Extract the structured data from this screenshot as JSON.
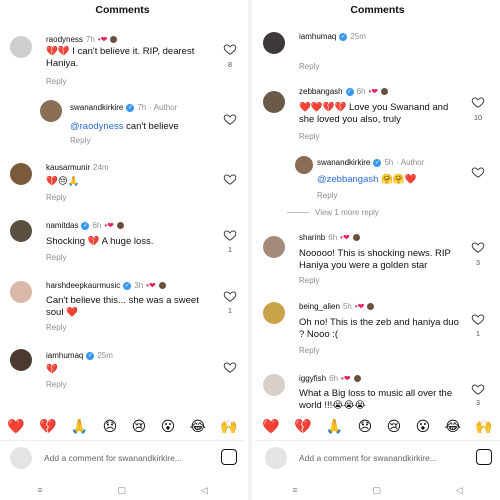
{
  "left": {
    "title": "Comments",
    "comments": [
      {
        "user": "raodyness",
        "time": "7h",
        "text": "💔💔 I can't believe it. RIP, dearest Haniya.",
        "reply": "Reply",
        "likes": "8"
      },
      {
        "user": "swanandkirkire",
        "time": "7h",
        "author": "· Author",
        "mention": "@raodyness",
        "text": " can't believe",
        "reply": "Reply"
      },
      {
        "user": "kausarmunir",
        "time": "24m",
        "text": "💔😔🙏",
        "reply": "Reply"
      },
      {
        "user": "namitdas",
        "time": "6h",
        "text": "Shocking 💔 A huge loss.",
        "reply": "Reply",
        "likes": "1"
      },
      {
        "user": "harshdeepkaurmusic",
        "time": "3h",
        "text": "Can't believe this... she was a sweet soul ❤️",
        "reply": "Reply",
        "likes": "1"
      },
      {
        "user": "iamhumaq",
        "time": "25m",
        "text": "💔",
        "reply": "Reply"
      }
    ],
    "input_placeholder": "Add a comment for swanandkirkire..."
  },
  "right": {
    "title": "Comments",
    "comments": [
      {
        "user": "iamhumaq",
        "time": "25m",
        "reply": "Reply"
      },
      {
        "user": "zebbangash",
        "time": "6h",
        "text": "❤️❤️💔💔 Love you Swanand and she loved you also, truly",
        "reply": "Reply",
        "likes": "10"
      },
      {
        "user": "swanandkirkire",
        "time": "5h",
        "author": "· Author",
        "mention": "@zebbangash",
        "text": " 🤗🤗❤️",
        "reply": "Reply"
      },
      {
        "user": "sharinb",
        "time": "6h",
        "text": "Nooooo! This is shocking news. RIP Haniya you were a golden star",
        "reply": "Reply",
        "likes": "3"
      },
      {
        "user": "being_alien",
        "time": "5h",
        "text": "Oh no! This is the zeb and haniya duo ? Nooo :(",
        "reply": "Reply",
        "likes": "1"
      },
      {
        "user": "iggyfish",
        "time": "6h",
        "text": "What a Big loss to music all over the world !!!😭😭😭",
        "likes": "3"
      }
    ],
    "view_more": "View 1 more reply",
    "input_placeholder": "Add a comment for swanandkirkire..."
  },
  "emojis": [
    "❤️",
    "💔",
    "🙏",
    "😞",
    "😢",
    "😮",
    "😂",
    "🙌"
  ],
  "nav": [
    "≡",
    "▢",
    "◁"
  ],
  "colors": {
    "link": "#2a6bd8",
    "verified": "#3897f0",
    "muted": "#8e8e8e",
    "heart_red": "#e0245e"
  }
}
